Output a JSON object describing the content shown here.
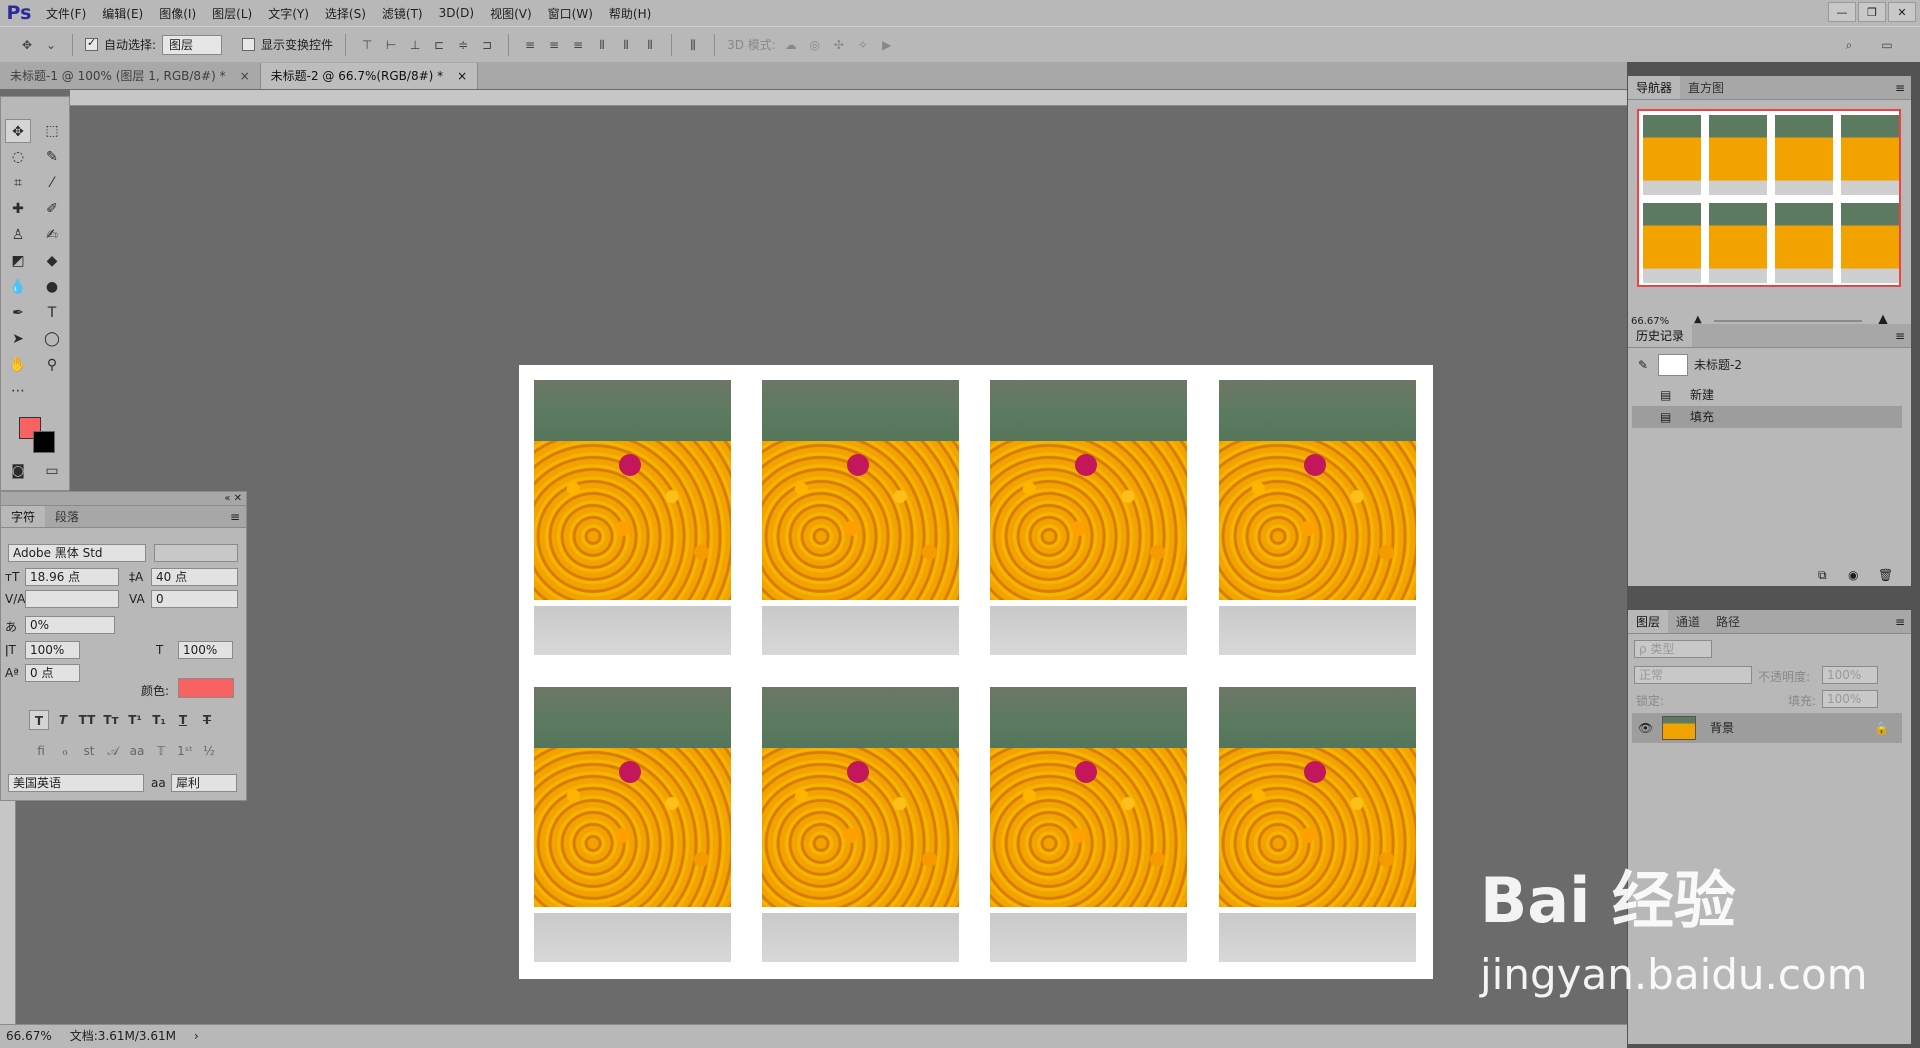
{
  "menubar": {
    "logo": "Ps",
    "items": [
      "文件(F)",
      "编辑(E)",
      "图像(I)",
      "图层(L)",
      "文字(Y)",
      "选择(S)",
      "滤镜(T)",
      "3D(D)",
      "视图(V)",
      "窗口(W)",
      "帮助(H)"
    ]
  },
  "options": {
    "auto_select_label": "自动选择:",
    "auto_select_value": "图层",
    "show_transform_label": "显示变换控件",
    "mode_3d_label": "3D 模式:"
  },
  "tabs": [
    {
      "label": "未标题-1 @ 100% (图层 1, RGB/8#) *",
      "close": "×"
    },
    {
      "label": "未标题-2 @ 66.7%(RGB/8#) *",
      "close": "×"
    }
  ],
  "char_panel": {
    "tabs": [
      "字符",
      "段落"
    ],
    "font_family": "Adobe 黑体 Std",
    "font_size": "18.96 点",
    "leading": "40 点",
    "kerning": "",
    "tracking": "0",
    "scale_percent": "0%",
    "vscale": "100%",
    "hscale": "100%",
    "baseline": "0 点",
    "color_label": "颜色:",
    "language": "美国英语",
    "antialias": "犀利",
    "antialias_icon": "aa"
  },
  "navigator": {
    "tabs": [
      "导航器",
      "直方图"
    ],
    "zoom": "66.67%"
  },
  "history": {
    "tab": "历史记录",
    "items": [
      {
        "label": "未标题-2"
      },
      {
        "label": "新建"
      },
      {
        "label": "填充"
      }
    ]
  },
  "layers": {
    "tabs": [
      "图层",
      "通道",
      "路径"
    ],
    "filter_kind": "ρ 类型",
    "blend_mode": "正常",
    "opacity_label": "不透明度:",
    "opacity_value": "100%",
    "lock_label": "锁定:",
    "fill_label": "填充:",
    "fill_value": "100%",
    "layer_name": "背景"
  },
  "status": {
    "zoom": "66.67%",
    "doc": "文档:3.61M/3.61M"
  },
  "watermark": {
    "text": "Bai 经验",
    "url": "jingyan.baidu.com"
  },
  "colors": {
    "foreground": "#f96262",
    "background": "#000000",
    "accent": "#e94343"
  }
}
